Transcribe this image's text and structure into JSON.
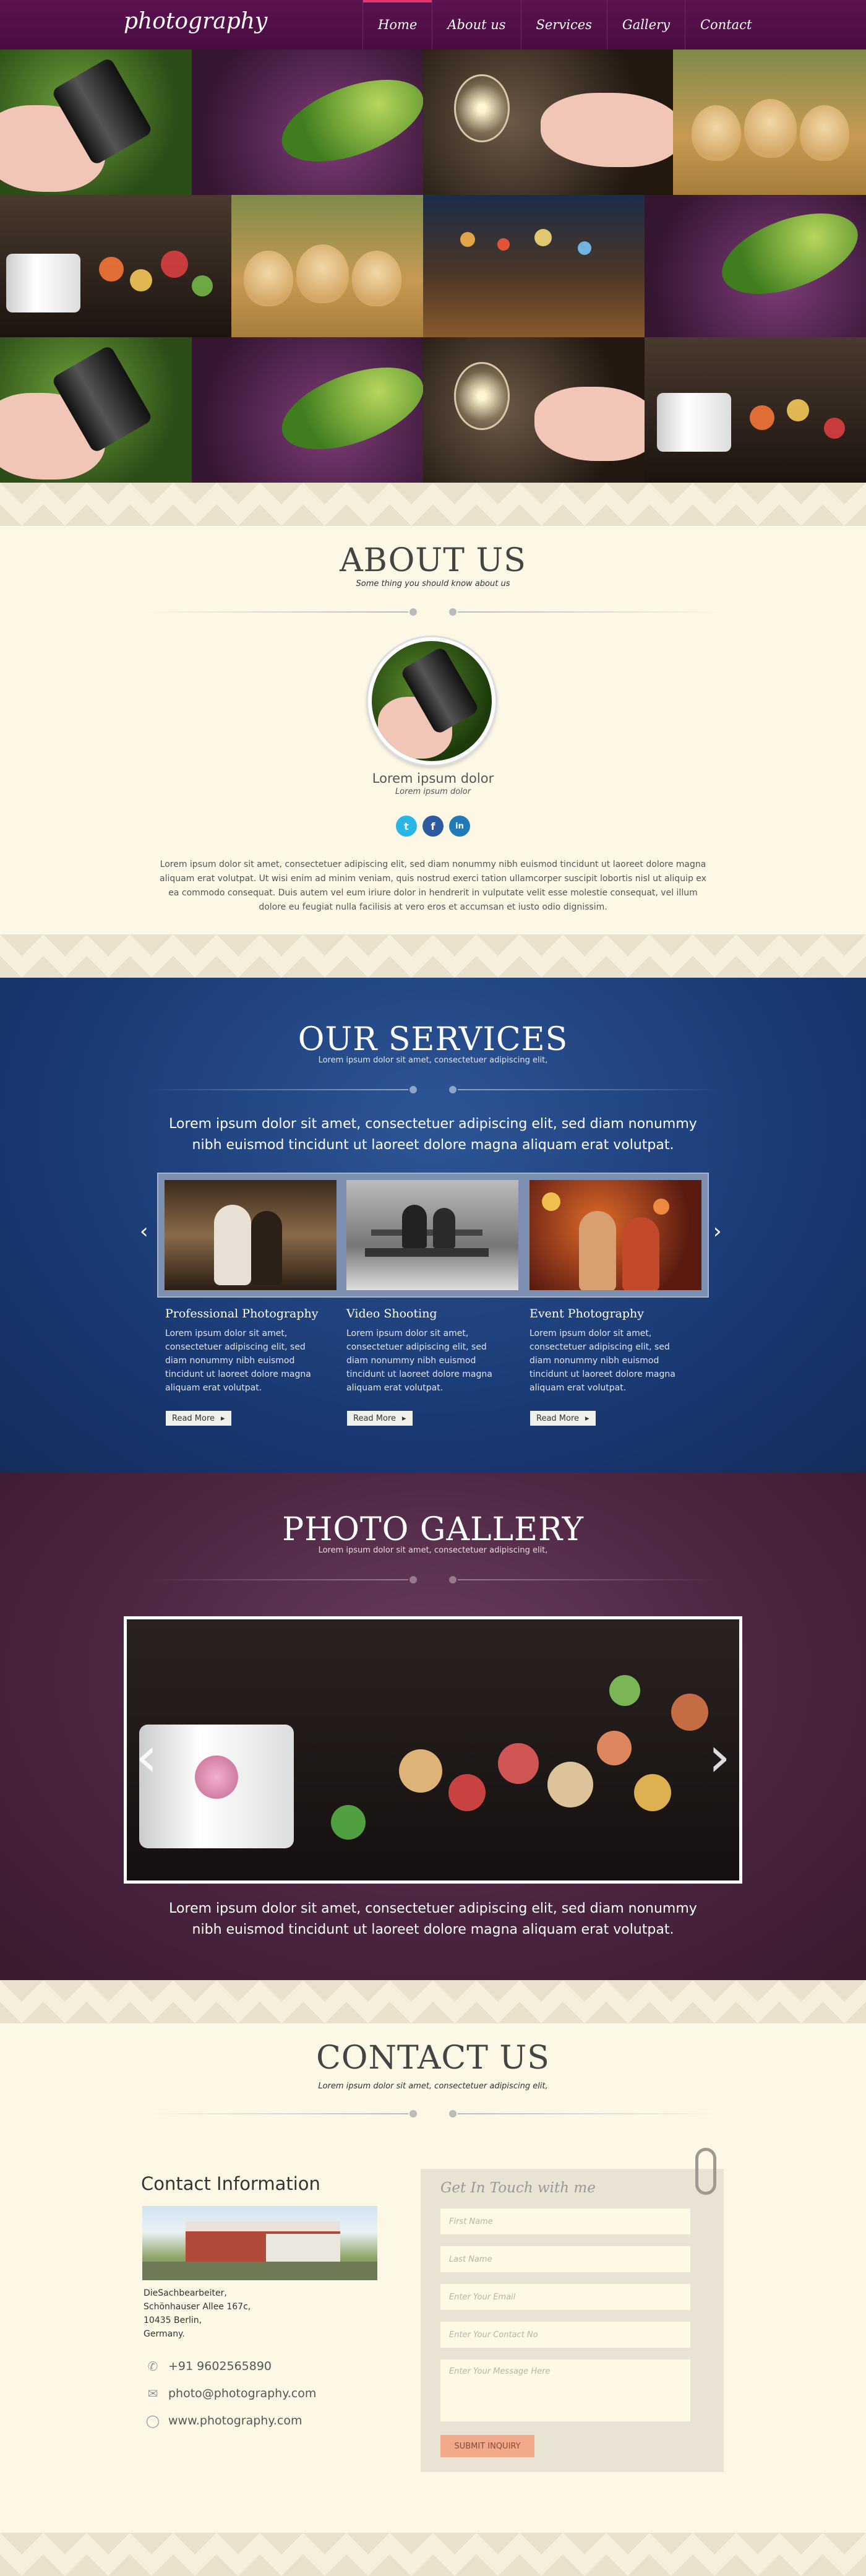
{
  "header": {
    "logo": "photography",
    "nav": [
      "Home",
      "About us",
      "Services",
      "Gallery",
      "Contact"
    ]
  },
  "about": {
    "title": "ABOUT US",
    "subtitle": "Some thing you should know about us",
    "name": "Lorem ipsum dolor",
    "role": "Lorem ipsum dolor",
    "social": [
      {
        "icon": "twitter-icon",
        "glyph": "t",
        "color": "#29b6e6"
      },
      {
        "icon": "facebook-icon",
        "glyph": "f",
        "color": "#2d5aa0"
      },
      {
        "icon": "linkedin-icon",
        "glyph": "in",
        "color": "#1f7bb8"
      }
    ],
    "text": "Lorem ipsum dolor sit amet, consectetuer adipiscing elit, sed diam nonummy nibh euismod tincidunt ut laoreet dolore magna aliquam erat volutpat. Ut wisi enim ad minim veniam, quis nostrud exerci tation ullamcorper suscipit lobortis nisl ut aliquip ex ea commodo consequat. Duis autem vel eum iriure dolor in hendrerit in vulputate velit esse molestie consequat, vel illum dolore eu feugiat nulla facilisis at vero eros et accumsan et iusto odio dignissim."
  },
  "services": {
    "title": "OUR SERVICES",
    "subtitle": "Lorem ipsum dolor sit amet, consectetuer adipiscing elit,",
    "lead": "Lorem ipsum dolor sit amet, consectetuer adipiscing elit, sed diam nonummy nibh euismod tincidunt ut laoreet dolore magna aliquam erat volutpat.",
    "items": [
      {
        "title": "Professional Photography",
        "text": "Lorem ipsum dolor sit amet, consectetuer adipiscing elit, sed diam nonummy nibh euismod tincidunt ut laoreet dolore magna aliquam erat volutpat.",
        "more": "Read  More"
      },
      {
        "title": "Video Shooting",
        "text": "Lorem ipsum dolor sit amet, consectetuer adipiscing elit, sed diam nonummy nibh euismod tincidunt ut laoreet dolore magna aliquam erat volutpat.",
        "more": "Read  More"
      },
      {
        "title": "Event Photography",
        "text": "Lorem ipsum dolor sit amet, consectetuer adipiscing elit, sed diam nonummy nibh euismod tincidunt ut laoreet dolore magna aliquam erat volutpat.",
        "more": "Read  More"
      }
    ]
  },
  "gallery": {
    "title": "PHOTO GALLERY",
    "subtitle": "Lorem ipsum dolor sit amet, consectetuer adipiscing elit,",
    "lead": "Lorem ipsum dolor sit amet, consectetuer adipiscing elit, sed diam nonummy nibh euismod tincidunt ut laoreet dolore magna aliquam erat volutpat."
  },
  "contact": {
    "title": "CONTACT US",
    "subtitle": "Lorem ipsum dolor sit amet, consectetuer adipiscing elit,",
    "info_heading": "Contact Information",
    "address": [
      "DieSachbearbeiter,",
      "Schönhauser Allee 167c,",
      "10435 Berlin,",
      "Germany."
    ],
    "phone": "+91 9602565890",
    "email": "photo@photography.com",
    "website": "www.photography.com",
    "form": {
      "title": "Get In Touch with me",
      "first_name": "First Name",
      "last_name": "Last Name",
      "email": "Enter Your Email",
      "contact_no": "Enter Your Contact No",
      "message": "Enter Your Message Here",
      "submit": "SUBMIT INQUIRY"
    }
  },
  "colors": {
    "header": "#4f0f46",
    "accent": "#e3356f",
    "services_bg": "#1f4180",
    "gallery_bg": "#4c2541",
    "cream": "#fdf7e6"
  }
}
